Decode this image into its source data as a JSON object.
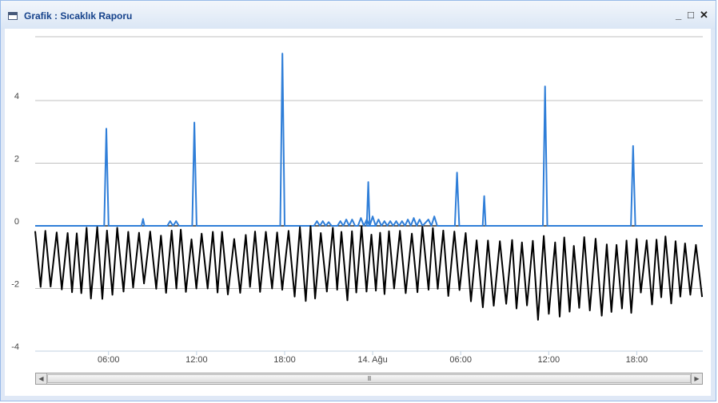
{
  "window": {
    "title": "Grafik : Sıcaklık Raporu",
    "minimize_glyph": "_",
    "maximize_glyph": "□",
    "close_glyph": "✕"
  },
  "scrollbar": {
    "left_arrow": "◀",
    "right_arrow": "▶",
    "thumb_grip": "III"
  },
  "chart_data": {
    "type": "line",
    "title": "",
    "xlabel": "",
    "ylabel": "",
    "ylim": [
      -4.2,
      6
    ],
    "yticks": [
      4,
      2,
      0,
      -2,
      -4
    ],
    "xlim": [
      0,
      45.5
    ],
    "xticks": [
      {
        "value": 5,
        "label": "06:00"
      },
      {
        "value": 11,
        "label": "12:00"
      },
      {
        "value": 17,
        "label": "18:00"
      },
      {
        "value": 23,
        "label": "14. Ağu"
      },
      {
        "value": 29,
        "label": "06:00"
      },
      {
        "value": 35,
        "label": "12:00"
      },
      {
        "value": 41,
        "label": "18:00"
      }
    ],
    "grid": true,
    "legend": "none",
    "series": [
      {
        "color": "#2f7ed8",
        "values": [
          [
            0,
            0
          ],
          [
            4.7,
            0
          ],
          [
            4.85,
            3.1
          ],
          [
            5.0,
            0
          ],
          [
            7.25,
            0
          ],
          [
            7.35,
            0.22
          ],
          [
            7.45,
            0
          ],
          [
            9.0,
            0
          ],
          [
            9.2,
            0.15
          ],
          [
            9.4,
            0
          ],
          [
            9.6,
            0.15
          ],
          [
            9.8,
            0
          ],
          [
            10.7,
            0
          ],
          [
            10.85,
            3.3
          ],
          [
            11.0,
            0
          ],
          [
            16.7,
            0
          ],
          [
            16.85,
            5.5
          ],
          [
            17.0,
            0
          ],
          [
            19.0,
            0
          ],
          [
            19.2,
            0.15
          ],
          [
            19.4,
            0
          ],
          [
            19.6,
            0.15
          ],
          [
            19.8,
            0
          ],
          [
            20.0,
            0.12
          ],
          [
            20.2,
            0
          ],
          [
            20.6,
            0
          ],
          [
            20.8,
            0.15
          ],
          [
            21.0,
            0
          ],
          [
            21.2,
            0.2
          ],
          [
            21.4,
            0
          ],
          [
            21.6,
            0.2
          ],
          [
            21.8,
            0
          ],
          [
            22.0,
            0
          ],
          [
            22.2,
            0.25
          ],
          [
            22.4,
            0
          ],
          [
            22.6,
            0.2
          ],
          [
            22.8,
            0
          ],
          [
            23.0,
            0.3
          ],
          [
            23.2,
            0
          ],
          [
            22.6,
            0
          ],
          [
            22.7,
            1.4
          ],
          [
            22.8,
            0
          ],
          [
            23.2,
            0
          ],
          [
            23.4,
            0.2
          ],
          [
            23.6,
            0
          ],
          [
            23.8,
            0.15
          ],
          [
            24.0,
            0
          ],
          [
            24.2,
            0.15
          ],
          [
            24.4,
            0
          ],
          [
            24.6,
            0.15
          ],
          [
            24.8,
            0
          ],
          [
            25.0,
            0.15
          ],
          [
            25.2,
            0
          ],
          [
            25.4,
            0.2
          ],
          [
            25.6,
            0
          ],
          [
            25.8,
            0.25
          ],
          [
            26.0,
            0
          ],
          [
            26.2,
            0.2
          ],
          [
            26.4,
            0
          ],
          [
            26.8,
            0.2
          ],
          [
            27.0,
            0
          ],
          [
            27.2,
            0.3
          ],
          [
            27.4,
            0
          ],
          [
            28.6,
            0
          ],
          [
            28.75,
            1.7
          ],
          [
            28.9,
            0
          ],
          [
            30.5,
            0
          ],
          [
            30.6,
            0.95
          ],
          [
            30.7,
            0
          ],
          [
            34.6,
            0
          ],
          [
            34.75,
            4.45
          ],
          [
            34.9,
            0
          ],
          [
            40.6,
            0
          ],
          [
            40.75,
            2.55
          ],
          [
            40.9,
            0
          ],
          [
            45.5,
            0
          ]
        ]
      },
      {
        "color": "#000000",
        "pattern": {
          "step_hours": 0.36,
          "segments": [
            {
              "until": 7.0,
              "low": -1.9,
              "high": 0.0
            },
            {
              "until": 16.0,
              "low": -1.8,
              "high": -0.1
            },
            {
              "until": 30.0,
              "low": -2.0,
              "high": 0.0
            },
            {
              "until": 34.0,
              "low": -2.2,
              "high": -0.3
            },
            {
              "until": 41.0,
              "low": -2.6,
              "high": -0.3
            },
            {
              "until": 45.5,
              "low": -2.1,
              "high": -0.3
            }
          ]
        },
        "values": []
      }
    ]
  }
}
